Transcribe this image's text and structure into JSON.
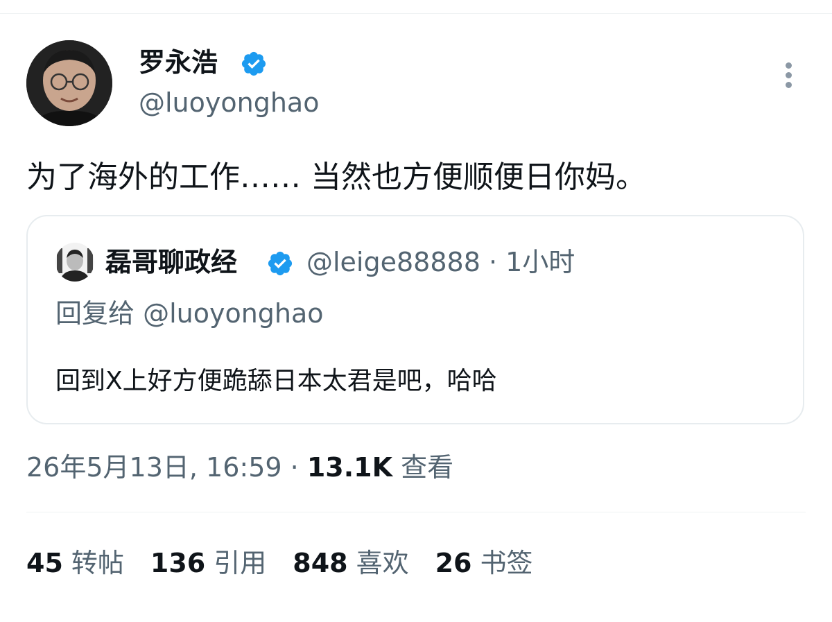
{
  "author": {
    "display_name": "罗永浩",
    "handle": "@luoyonghao",
    "verified_icon": "verified-badge-icon",
    "avatar_icon": "avatar-portrait"
  },
  "tweet": {
    "text": "为了海外的工作…… 当然也方便顺便日你妈。",
    "timestamp": "26年5月13日, 16:59",
    "separator": "·",
    "views_count": "13.1K",
    "views_label": "查看"
  },
  "quote": {
    "display_name": "磊哥聊政经",
    "handle_and_time": "@leige88888 · 1小时",
    "reply_to": "回复给 @luoyonghao",
    "text": "回到X上好方便跪舔日本太君是吧，哈哈"
  },
  "stats": [
    {
      "count": "45",
      "label": "转帖"
    },
    {
      "count": "136",
      "label": "引用"
    },
    {
      "count": "848",
      "label": "喜欢"
    },
    {
      "count": "26",
      "label": "书签"
    }
  ],
  "colors": {
    "verified": "#1d9bf0",
    "secondary_text": "#536471",
    "primary_text": "#0f1419",
    "border": "#e7ecef"
  }
}
